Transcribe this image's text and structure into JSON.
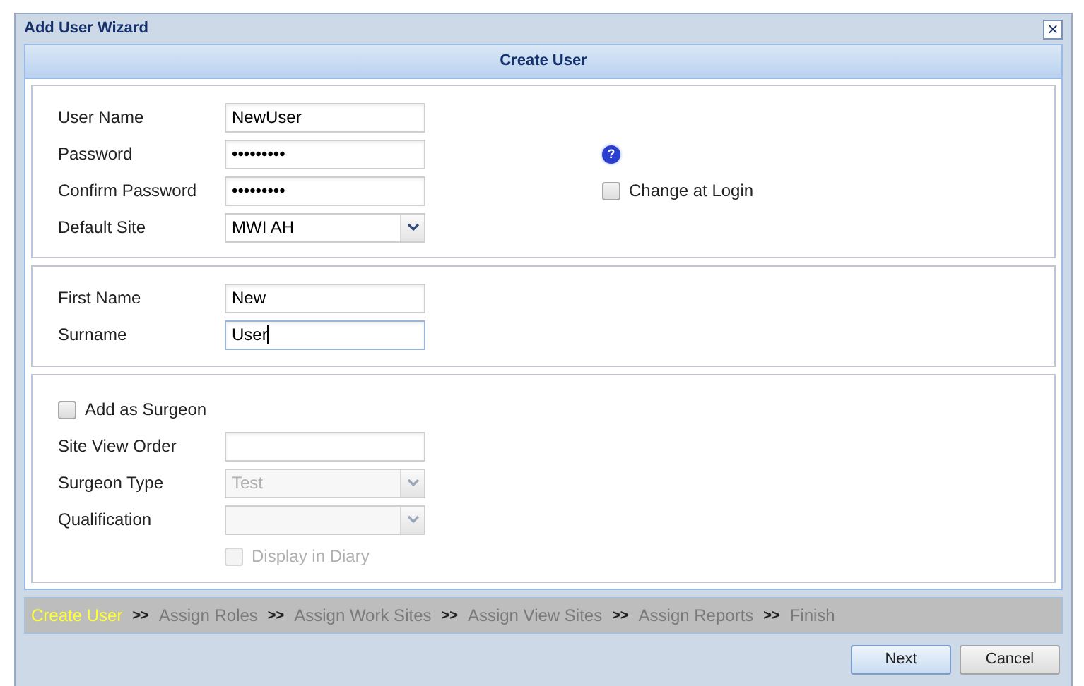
{
  "window": {
    "title": "Add User Wizard",
    "close": "×"
  },
  "header": "Create User",
  "sections": [
    {
      "rows": [
        {
          "kind": "text",
          "label": "User Name",
          "value": "NewUser",
          "disabled": false
        },
        {
          "kind": "text",
          "label": "Password",
          "value": "•••••••••",
          "disabled": false,
          "extra": {
            "kind": "help",
            "label": "?"
          }
        },
        {
          "kind": "text",
          "label": "Confirm Password",
          "value": "•••••••••",
          "disabled": false,
          "extra": {
            "kind": "checkbox",
            "label": "Change at Login",
            "checked": false
          }
        },
        {
          "kind": "select",
          "label": "Default Site",
          "value": "MWI AH",
          "disabled": false
        }
      ]
    },
    {
      "rows": [
        {
          "kind": "text",
          "label": "First Name",
          "value": "New",
          "disabled": false
        },
        {
          "kind": "text",
          "label": "Surname",
          "value": "User",
          "disabled": false,
          "focused": true
        }
      ]
    },
    {
      "rows": [
        {
          "kind": "checkbox",
          "label": "Add as Surgeon",
          "checked": false,
          "disabled": false
        },
        {
          "kind": "text",
          "label": "Site View Order",
          "disabled": false
        },
        {
          "kind": "select",
          "label": "Surgeon Type",
          "value": "Test",
          "disabled": true
        },
        {
          "kind": "select",
          "label": "Qualification",
          "disabled": true
        },
        {
          "kind": "subcheckbox",
          "label": "Display in Diary",
          "checked": false,
          "disabled": true
        }
      ]
    }
  ],
  "steps": [
    {
      "label": "Create User",
      "selected": true
    },
    {
      "kind": "sep",
      "label": ">>"
    },
    {
      "label": "Assign Roles",
      "selected": false
    },
    {
      "kind": "sep",
      "label": ">>"
    },
    {
      "label": "Assign Work Sites",
      "selected": false
    },
    {
      "kind": "sep",
      "label": ">>"
    },
    {
      "label": "Assign View Sites",
      "selected": false
    },
    {
      "kind": "sep",
      "label": ">>"
    },
    {
      "label": "Assign Reports",
      "selected": false
    },
    {
      "kind": "sep",
      "label": ">>"
    },
    {
      "label": "Finish",
      "selected": false
    }
  ],
  "buttons": [
    {
      "label": "Next",
      "primary": true
    },
    {
      "label": "Cancel",
      "primary": false
    }
  ]
}
